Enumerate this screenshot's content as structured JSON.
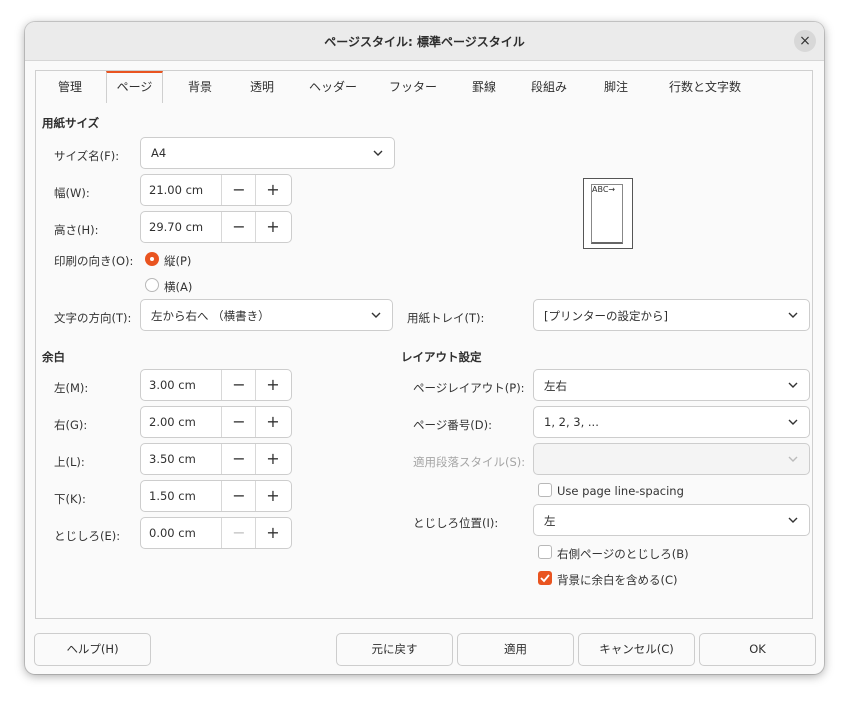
{
  "window": {
    "title": "ページスタイル: 標準ページスタイル",
    "close_icon": "close-icon"
  },
  "tabs": [
    {
      "label": "管理",
      "active": false
    },
    {
      "label": "ページ",
      "active": true
    },
    {
      "label": "背景",
      "active": false
    },
    {
      "label": "透明",
      "active": false
    },
    {
      "label": "ヘッダー",
      "active": false
    },
    {
      "label": "フッター",
      "active": false
    },
    {
      "label": "罫線",
      "active": false
    },
    {
      "label": "段組み",
      "active": false
    },
    {
      "label": "脚注",
      "active": false
    },
    {
      "label": "行数と文字数",
      "active": false
    }
  ],
  "paper": {
    "heading": "用紙サイズ",
    "format_label": "サイズ名(F):",
    "format_value": "A4",
    "width_label": "幅(W):",
    "width_value": "21.00 cm",
    "height_label": "高さ(H):",
    "height_value": "29.70 cm",
    "orientation_label": "印刷の向き(O):",
    "portrait_label": "縦(P)",
    "portrait_selected": true,
    "landscape_label": "横(A)",
    "landscape_selected": false,
    "text_direction_label": "文字の方向(T):",
    "text_direction_value": "左から右へ （横書き）",
    "tray_label": "用紙トレイ(T):",
    "tray_value": "[プリンターの設定から]",
    "preview_text": "ABC→"
  },
  "margins": {
    "heading": "余白",
    "left_label": "左(M):",
    "left_value": "3.00 cm",
    "right_label": "右(G):",
    "right_value": "2.00 cm",
    "top_label": "上(L):",
    "top_value": "3.50 cm",
    "bottom_label": "下(K):",
    "bottom_value": "1.50 cm",
    "gutter_label": "とじしろ(E):",
    "gutter_value": "0.00 cm"
  },
  "layout": {
    "heading": "レイアウト設定",
    "page_layout_label": "ページレイアウト(P):",
    "page_layout_value": "左右",
    "page_numbers_label": "ページ番号(D):",
    "page_numbers_value": "1, 2, 3, ...",
    "ref_style_label": "適用段落スタイル(S):",
    "ref_style_value": "",
    "line_spacing_label": "Use page line-spacing",
    "line_spacing_checked": false,
    "gutter_pos_label": "とじしろ位置(I):",
    "gutter_pos_value": "左",
    "right_gutter_label": "右側ページのとじしろ(B)",
    "right_gutter_checked": false,
    "bg_margins_label": "背景に余白を含める(C)",
    "bg_margins_checked": true
  },
  "buttons": {
    "help": "ヘルプ(H)",
    "reset": "元に戻す",
    "apply": "適用",
    "cancel": "キャンセル(C)",
    "ok": "OK"
  },
  "colors": {
    "accent": "#e95420"
  }
}
